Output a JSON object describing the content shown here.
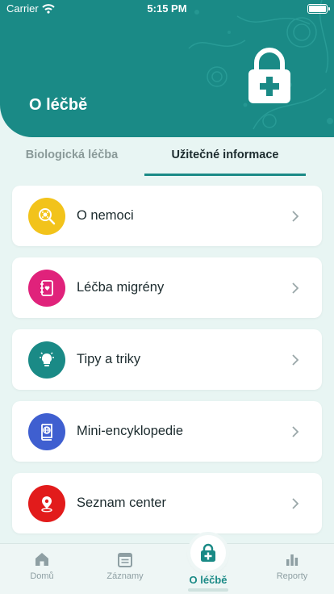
{
  "status_bar": {
    "carrier": "Carrier",
    "time": "5:15 PM"
  },
  "header": {
    "title": "O léčbě",
    "icon": "lock-plus-icon"
  },
  "tabs": [
    {
      "label": "Biologická léčba",
      "active": false
    },
    {
      "label": "Užitečné informace",
      "active": true
    }
  ],
  "items": [
    {
      "label": "O nemoci",
      "icon": "search-virus-icon",
      "color": "#f2c31b"
    },
    {
      "label": "Léčba migrény",
      "icon": "notebook-heart-icon",
      "color": "#e0227b"
    },
    {
      "label": "Tipy a triky",
      "icon": "lightbulb-icon",
      "color": "#1a8a86"
    },
    {
      "label": "Mini-encyklopedie",
      "icon": "book-globe-icon",
      "color": "#3f5fd0"
    },
    {
      "label": "Seznam center",
      "icon": "location-pin-icon",
      "color": "#e21b1b"
    }
  ],
  "nav": [
    {
      "label": "Domů",
      "icon": "home-icon",
      "active": false
    },
    {
      "label": "Záznamy",
      "icon": "calendar-icon",
      "active": false
    },
    {
      "label": "O léčbě",
      "icon": "lock-plus-icon",
      "active": true
    },
    {
      "label": "Reporty",
      "icon": "bar-chart-icon",
      "active": false
    }
  ],
  "colors": {
    "brand": "#1a8a86",
    "background": "#e8f5f3"
  }
}
